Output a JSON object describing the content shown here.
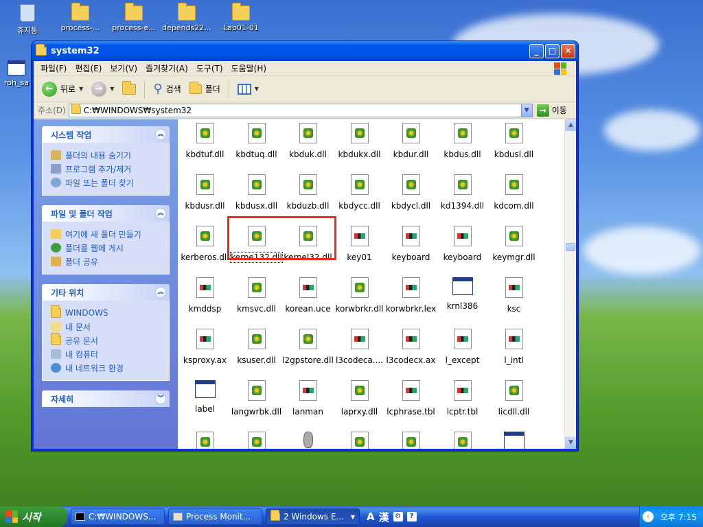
{
  "desktop": {
    "icons": [
      {
        "label": "휴지통",
        "type": "bin"
      },
      {
        "label": "process-...",
        "type": "folder"
      },
      {
        "label": "process-e...",
        "type": "folder"
      },
      {
        "label": "depends22...",
        "type": "folder"
      },
      {
        "label": "Lab01-01",
        "type": "folder"
      },
      {
        "label": "roh_sa",
        "type": "window"
      }
    ]
  },
  "window": {
    "title": "system32",
    "buttons": {
      "minimize": "_",
      "maximize": "□",
      "close": "✕"
    },
    "menu": [
      "파일(F)",
      "편집(E)",
      "보기(V)",
      "즐겨찾기(A)",
      "도구(T)",
      "도움말(H)"
    ],
    "toolbar": {
      "back": "뒤로",
      "search": "검색",
      "folders": "폴더"
    },
    "address": {
      "label": "주소(D)",
      "value": "C:₩WINDOWS₩system32",
      "go": "이동"
    }
  },
  "taskpane": {
    "panels": [
      {
        "title": "시스템 작업",
        "links": [
          "폴더의 내용 숨기기",
          "프로그램 추가/제거",
          "파일 또는 폴더 찾기"
        ]
      },
      {
        "title": "파일 및 폴더 작업",
        "links": [
          "여기에 새 폴더 만들기",
          "폴더를 웹에 게시",
          "폴더 공유"
        ]
      },
      {
        "title": "기타 위치",
        "links": [
          "WINDOWS",
          "내 문서",
          "공유 문서",
          "내 컴퓨터",
          "내 네트워크 환경"
        ]
      },
      {
        "title": "자세히",
        "links": []
      }
    ]
  },
  "files": [
    {
      "name": "kbdtuf.dll",
      "icon": "dll"
    },
    {
      "name": "kbdtuq.dll",
      "icon": "dll"
    },
    {
      "name": "kbduk.dll",
      "icon": "dll"
    },
    {
      "name": "kbdukx.dll",
      "icon": "dll"
    },
    {
      "name": "kbdur.dll",
      "icon": "dll"
    },
    {
      "name": "kbdus.dll",
      "icon": "dll"
    },
    {
      "name": "kbdusl.dll",
      "icon": "dll"
    },
    {
      "name": "kbdusr.dll",
      "icon": "dll"
    },
    {
      "name": "kbdusx.dll",
      "icon": "dll"
    },
    {
      "name": "kbduzb.dll",
      "icon": "dll"
    },
    {
      "name": "kbdycc.dll",
      "icon": "dll"
    },
    {
      "name": "kbdycl.dll",
      "icon": "dll"
    },
    {
      "name": "kd1394.dll",
      "icon": "dll"
    },
    {
      "name": "kdcom.dll",
      "icon": "dll"
    },
    {
      "name": "kerberos.dll",
      "icon": "dll"
    },
    {
      "name": "kerne132.dll",
      "icon": "dll",
      "selected": true
    },
    {
      "name": "kernel32.dll",
      "icon": "dll"
    },
    {
      "name": "key01",
      "icon": "doc"
    },
    {
      "name": "keyboard",
      "icon": "doc"
    },
    {
      "name": "keyboard",
      "icon": "doc"
    },
    {
      "name": "keymgr.dll",
      "icon": "dll"
    },
    {
      "name": "kmddsp",
      "icon": "doc"
    },
    {
      "name": "kmsvc.dll",
      "icon": "dll"
    },
    {
      "name": "korean.uce",
      "icon": "doc"
    },
    {
      "name": "korwbrkr.dll",
      "icon": "dll"
    },
    {
      "name": "korwbrkr.lex",
      "icon": "doc"
    },
    {
      "name": "krnl386",
      "icon": "win"
    },
    {
      "name": "ksc",
      "icon": "doc"
    },
    {
      "name": "ksproxy.ax",
      "icon": "doc"
    },
    {
      "name": "ksuser.dll",
      "icon": "dll"
    },
    {
      "name": "l2gpstore.dll",
      "icon": "dll"
    },
    {
      "name": "l3codeca....",
      "icon": "doc"
    },
    {
      "name": "l3codecx.ax",
      "icon": "doc"
    },
    {
      "name": "l_except",
      "icon": "doc"
    },
    {
      "name": "l_intl",
      "icon": "doc"
    },
    {
      "name": "label",
      "icon": "win"
    },
    {
      "name": "langwrbk.dll",
      "icon": "dll"
    },
    {
      "name": "lanman",
      "icon": "doc"
    },
    {
      "name": "laprxy.dll",
      "icon": "dll"
    },
    {
      "name": "lcphrase.tbl",
      "icon": "doc"
    },
    {
      "name": "lcptr.tbl",
      "icon": "doc"
    },
    {
      "name": "licdll.dll",
      "icon": "dll"
    },
    {
      "name": "",
      "icon": "dll"
    },
    {
      "name": "",
      "icon": "dll"
    },
    {
      "name": "",
      "icon": "plug"
    },
    {
      "name": "",
      "icon": "dll"
    },
    {
      "name": "",
      "icon": "dll"
    },
    {
      "name": "",
      "icon": "dll"
    },
    {
      "name": "",
      "icon": "win"
    }
  ],
  "taskbar": {
    "start": "시작",
    "tasks": [
      {
        "label": "C:₩WINDOWS...",
        "active": false
      },
      {
        "label": "Process Monit...",
        "active": false
      },
      {
        "label": "2 Windows E...",
        "active": true
      }
    ],
    "langbar": [
      "A",
      "漢"
    ],
    "clock": "오후 7:15"
  },
  "colors": {
    "highlight": "#ef2a1a",
    "link": "#215dc6",
    "titlebar": "#0058ee"
  }
}
